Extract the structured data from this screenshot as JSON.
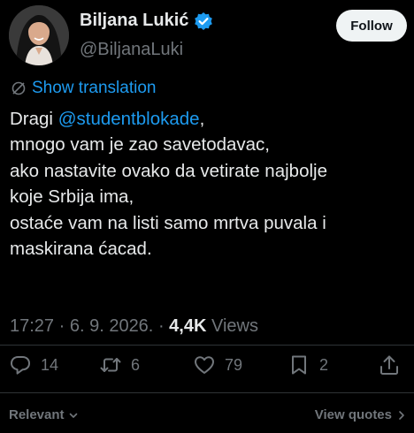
{
  "author": {
    "display_name": "Biljana Lukić",
    "handle": "@BiljanaLuki",
    "verified": true
  },
  "follow_label": "Follow",
  "translate_label": "Show translation",
  "tweet": {
    "greeting": "Dragi ",
    "mention": "@studentblokade",
    "mention_suffix": ",",
    "lines": [
      "mnogo vam je zao savetodavac,",
      "ako nastavite ovako da vetirate najbolje",
      "koje Srbija ima,",
      "ostaće vam na listi samo mrtva puvala i",
      "maskirana ćacad."
    ]
  },
  "meta": {
    "time": "17:27",
    "date": "6. 9. 2026.",
    "views_count": "4,4K",
    "views_label": "Views"
  },
  "actions": {
    "replies": "14",
    "reposts": "6",
    "likes": "79",
    "bookmarks": "2"
  },
  "footer": {
    "sort_label": "Relevant",
    "quotes_label": "View quotes"
  },
  "colors": {
    "background": "#000000",
    "text": "#e7e9ea",
    "muted": "#71767b",
    "accent": "#1d9bf0",
    "divider": "#2f3336"
  }
}
